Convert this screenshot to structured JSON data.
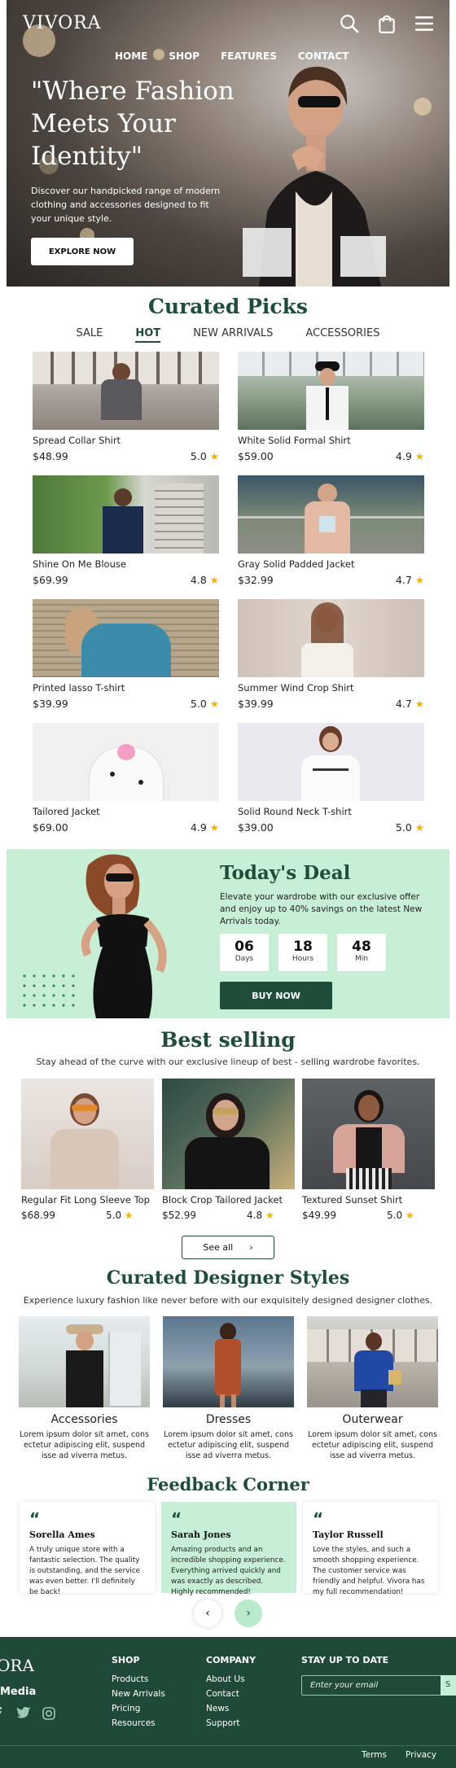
{
  "header": {
    "logo": "VIVORA",
    "nav": [
      "HOME",
      "SHOP",
      "FEATURES",
      "CONTACT"
    ],
    "icons": [
      "search-icon",
      "shopping-bag-icon",
      "menu-icon"
    ]
  },
  "hero": {
    "title": "\"Where Fashion Meets Your Identity\"",
    "subtitle": "Discover our handpicked range of modern clothing and accessories designed to fit your unique style.",
    "cta": "EXPLORE NOW"
  },
  "curated": {
    "title": "Curated Picks",
    "tabs": [
      "SALE",
      "HOT",
      "NEW ARRIVALS",
      "ACCESSORIES"
    ],
    "active_tab": "HOT",
    "products": [
      {
        "name": "Spread Collar Shirt",
        "price": "$48.99",
        "rating": "5.0"
      },
      {
        "name": "White Solid Formal Shirt",
        "price": "$59.00",
        "rating": "4.9"
      },
      {
        "name": "Shine On Me Blouse",
        "price": "$69.99",
        "rating": "4.8"
      },
      {
        "name": "Gray Solid Padded Jacket",
        "price": "$32.99",
        "rating": "4.7"
      },
      {
        "name": "Printed lasso T-shirt",
        "price": "$39.99",
        "rating": "5.0"
      },
      {
        "name": "Summer Wind Crop Shirt",
        "price": "$39.99",
        "rating": "4.7"
      },
      {
        "name": "Tailored Jacket",
        "price": "$69.00",
        "rating": "4.9"
      },
      {
        "name": "Solid Round Neck T-shirt",
        "price": "$39.00",
        "rating": "5.0"
      }
    ]
  },
  "deal": {
    "title": "Today's Deal",
    "subtitle": "Elevate your wardrobe with our exclusive offer and enjoy up to 40% savings on the latest New Arrivals today.",
    "timer": [
      {
        "value": "06",
        "label": "Days"
      },
      {
        "value": "18",
        "label": "Hours"
      },
      {
        "value": "48",
        "label": "Min"
      }
    ],
    "cta": "BUY NOW"
  },
  "best_selling": {
    "title": "Best selling",
    "subtitle": "Stay ahead of the curve with our exclusive lineup of best - selling wardrobe favorites.",
    "products": [
      {
        "name": "Regular Fit Long Sleeve Top",
        "price": "$68.99",
        "rating": "5.0"
      },
      {
        "name": "Block Crop Tailored Jacket",
        "price": "$52.99",
        "rating": "4.8"
      },
      {
        "name": "Textured Sunset Shirt",
        "price": "$49.99",
        "rating": "5.0"
      }
    ],
    "see_all": "See all"
  },
  "designer": {
    "title": "Curated Designer Styles",
    "subtitle": "Experience luxury fashion like never before with our exquisitely designed designer clothes.",
    "categories": [
      {
        "name": "Accessories",
        "desc": "Lorem ipsum dolor sit amet, cons ectetur adipiscing elit, suspend isse ad viverra metus."
      },
      {
        "name": "Dresses",
        "desc": "Lorem ipsum dolor sit amet, cons ectetur adipiscing elit, suspend isse ad viverra metus."
      },
      {
        "name": "Outerwear",
        "desc": "Lorem ipsum dolor sit amet, cons ectetur adipiscing elit, suspend isse ad viverra metus."
      }
    ]
  },
  "feedback": {
    "title": "Feedback Corner",
    "items": [
      {
        "name": "Sorella Ames",
        "text": "A truly unique store with a fantastic selection. The quality is outstanding, and the service was even better. I'll definitely be back!"
      },
      {
        "name": "Sarah Jones",
        "text": "Amazing products and an incredible shopping experience. Everything arrived quickly and was exactly as described. Highly recommended!"
      },
      {
        "name": "Taylor Russell",
        "text": "Love the styles, and such a smooth shopping experience. The customer service was friendly and helpful. Vivora has my full recommendation!"
      }
    ]
  },
  "footer": {
    "logo_partial": "ORA",
    "social_label": "Media",
    "shop_heading": "SHOP",
    "shop_links": [
      "Products",
      "New Arrivals",
      "Pricing",
      "Resources"
    ],
    "company_heading": "COMPANY",
    "company_links": [
      "About Us",
      "Contact",
      "News",
      "Support"
    ],
    "newsletter_heading": "STAY UP TO DATE",
    "email_placeholder": "Enter your email",
    "send_partial": "S",
    "bottom_links": [
      "Terms",
      "Privacy"
    ]
  },
  "colors": {
    "brand_green": "#1e4d3a",
    "mint": "#c7efd5",
    "star": "#f2b400"
  }
}
